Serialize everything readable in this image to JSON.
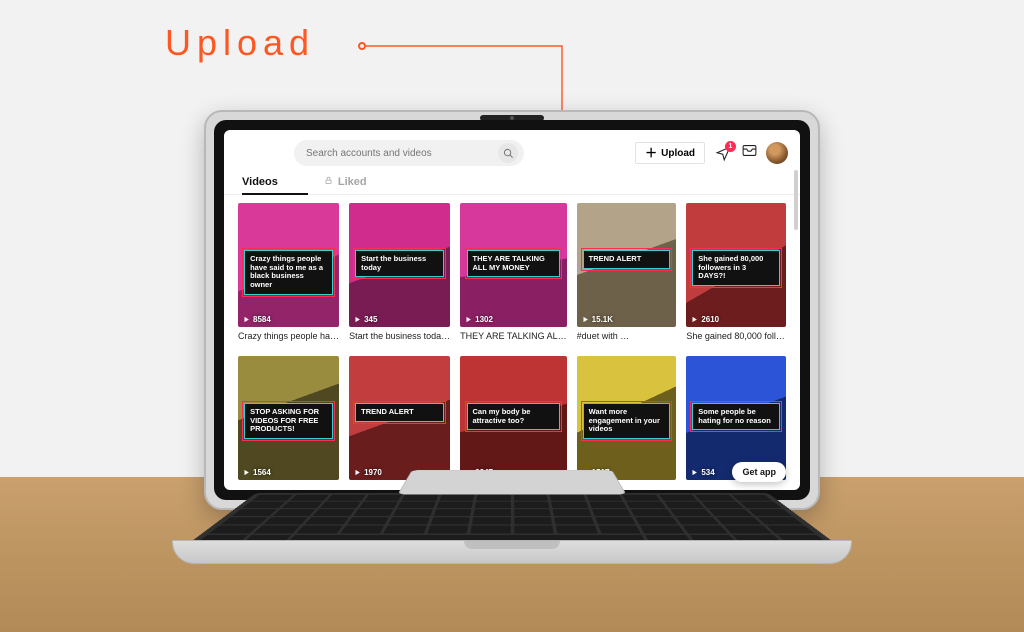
{
  "annotation": {
    "label": "Upload"
  },
  "header": {
    "search_placeholder": "Search accounts and videos",
    "upload_label": "Upload",
    "notification_count": "1"
  },
  "tabs": {
    "videos": "Videos",
    "liked": "Liked"
  },
  "videos_row1": [
    {
      "overlay": "Crazy things people have said to me as a black business owner",
      "views": "8584",
      "caption": "Crazy things people ha…",
      "style": "thumbA"
    },
    {
      "overlay": "Start the business today",
      "views": "345",
      "caption": "Start the business toda…",
      "style": "thumbB"
    },
    {
      "overlay": "THEY ARE TALKING ALL MY MONEY",
      "views": "1302",
      "caption": "THEY ARE TALKING AL…",
      "style": "thumbC"
    },
    {
      "overlay": "TREND ALERT",
      "views": "15.1K",
      "caption": "#duet with …",
      "style": "thumbD"
    },
    {
      "overlay": "She gained 80,000 followers in 3 DAYS?!",
      "views": "2610",
      "caption": "She gained 80,000 foll…",
      "style": "thumbE"
    }
  ],
  "videos_row2": [
    {
      "overlay": "STOP ASKING FOR VIDEOS FOR FREE PRODUCTS!",
      "views": "1564",
      "caption": "",
      "style": "thumbF"
    },
    {
      "overlay": "TREND ALERT",
      "views": "1970",
      "caption": "",
      "style": "thumbG"
    },
    {
      "overlay": "Can my body be attractive too?",
      "views": "2347",
      "caption": "",
      "style": "thumbH"
    },
    {
      "overlay": "Want more engagement in your videos",
      "views": "1517",
      "caption": "",
      "style": "thumbI"
    },
    {
      "overlay": "Some people be hating for no reason",
      "views": "534",
      "caption": "",
      "style": "thumbJ"
    }
  ],
  "get_app": "Get app"
}
